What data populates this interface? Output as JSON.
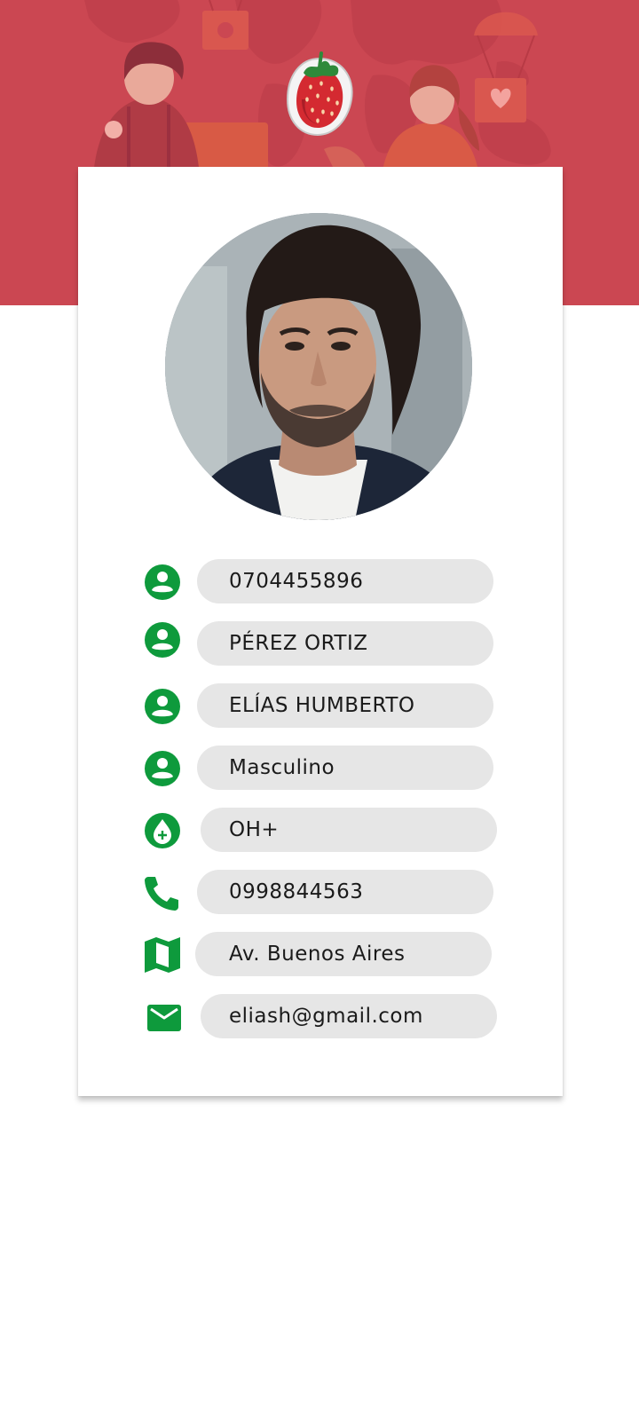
{
  "theme": {
    "header_color": "#cb4752",
    "icon_color": "#0e9a3c",
    "field_background": "#e6e6e6"
  },
  "header": {
    "logo_icon": "strawberry-logo",
    "illustration": "world-map-volunteers-with-parachute-aid-boxes"
  },
  "profile": {
    "photo": "profile-photo-man"
  },
  "fields": [
    {
      "id": "id-number",
      "icon": "account-circle-icon",
      "value": "0704455896"
    },
    {
      "id": "last-names",
      "icon": "account-circle-icon",
      "value": "PÉREZ ORTIZ"
    },
    {
      "id": "first-names",
      "icon": "account-circle-icon",
      "value": "ELÍAS HUMBERTO"
    },
    {
      "id": "gender",
      "icon": "account-circle-icon",
      "value": "Masculino"
    },
    {
      "id": "blood-type",
      "icon": "blood-drop-icon",
      "value": "OH+"
    },
    {
      "id": "phone",
      "icon": "phone-icon",
      "value": "0998844563"
    },
    {
      "id": "address",
      "icon": "map-icon",
      "value": "Av. Buenos Aires"
    },
    {
      "id": "email",
      "icon": "email-icon",
      "value": "eliash@gmail.com"
    }
  ]
}
